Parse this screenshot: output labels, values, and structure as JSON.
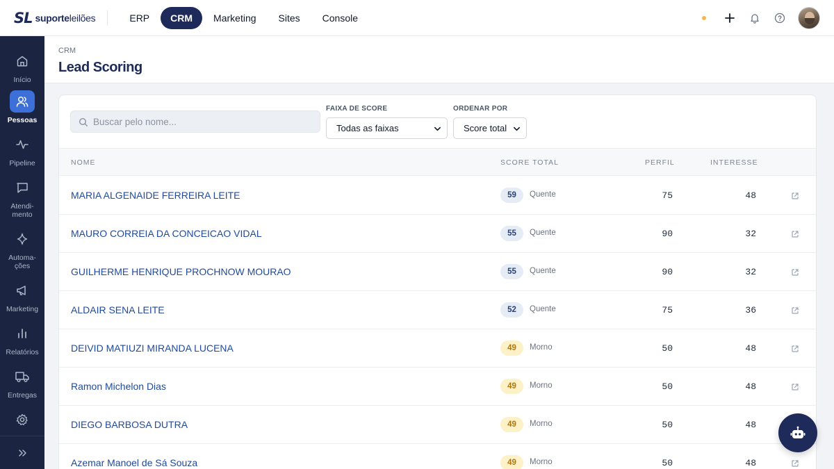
{
  "brand": {
    "mark": "SL",
    "name_bold": "suporte",
    "name_rest": "leilões"
  },
  "modules": [
    {
      "label": "ERP",
      "active": false
    },
    {
      "label": "CRM",
      "active": true
    },
    {
      "label": "Marketing",
      "active": false
    },
    {
      "label": "Sites",
      "active": false
    },
    {
      "label": "Console",
      "active": false
    }
  ],
  "topbar_icons": [
    "status-dot",
    "plus-icon",
    "bell-icon",
    "help-icon",
    "avatar"
  ],
  "sidebar": {
    "items": [
      {
        "label": "Início",
        "icon": "home-icon",
        "active": false
      },
      {
        "label": "Pessoas",
        "icon": "people-icon",
        "active": true
      },
      {
        "label": "Pipeline",
        "icon": "pulse-icon",
        "active": false
      },
      {
        "label": "Atendi-\nmento",
        "icon": "chat-icon",
        "active": false
      },
      {
        "label": "Automa-\nções",
        "icon": "sparkle-icon",
        "active": false
      },
      {
        "label": "Marketing",
        "icon": "megaphone-icon",
        "active": false
      },
      {
        "label": "Relatórios",
        "icon": "bar-chart-icon",
        "active": false
      },
      {
        "label": "Entregas",
        "icon": "truck-icon",
        "active": false
      },
      {
        "label": "",
        "icon": "gear-icon",
        "active": false
      }
    ],
    "collapse_icon": "double-chevron-right-icon"
  },
  "header": {
    "breadcrumb": "CRM",
    "title": "Lead Scoring"
  },
  "filters": {
    "search_placeholder": "Buscar pelo nome...",
    "search_value": "",
    "score_range_label": "FAIXA DE SCORE",
    "score_range_value": "Todas as faixas",
    "order_label": "ORDENAR POR",
    "order_value": "Score total"
  },
  "table": {
    "columns": {
      "name": "NOME",
      "score": "SCORE TOTAL",
      "profile": "PERFIL",
      "interest": "INTERESSE"
    },
    "rows": [
      {
        "name": "MARIA ALGENAIDE FERREIRA LEITE",
        "score": "59",
        "level": "Quente",
        "profile": "75",
        "interest": "48",
        "tone": "hot"
      },
      {
        "name": "MAURO CORREIA DA CONCEICAO VIDAL",
        "score": "55",
        "level": "Quente",
        "profile": "90",
        "interest": "32",
        "tone": "hot"
      },
      {
        "name": "GUILHERME HENRIQUE PROCHNOW MOURAO",
        "score": "55",
        "level": "Quente",
        "profile": "90",
        "interest": "32",
        "tone": "hot"
      },
      {
        "name": "ALDAIR SENA LEITE",
        "score": "52",
        "level": "Quente",
        "profile": "75",
        "interest": "36",
        "tone": "hot"
      },
      {
        "name": "DEIVID MATIUZI MIRANDA LUCENA",
        "score": "49",
        "level": "Morno",
        "profile": "50",
        "interest": "48",
        "tone": "warm"
      },
      {
        "name": "Ramon Michelon Dias",
        "score": "49",
        "level": "Morno",
        "profile": "50",
        "interest": "48",
        "tone": "warm"
      },
      {
        "name": "DIEGO BARBOSA DUTRA",
        "score": "49",
        "level": "Morno",
        "profile": "50",
        "interest": "48",
        "tone": "warm"
      },
      {
        "name": "Azemar Manoel de Sá Souza",
        "score": "49",
        "level": "Morno",
        "profile": "50",
        "interest": "48",
        "tone": "warm"
      }
    ]
  },
  "fab": {
    "icon": "robot-icon"
  },
  "colors": {
    "navy": "#1e2a5a",
    "sidebar": "#1b2440",
    "accent": "#3d6fd9",
    "link": "#1f4a9c",
    "hot_bg": "#e6ecf6",
    "warm_bg": "#fdf1c8"
  }
}
